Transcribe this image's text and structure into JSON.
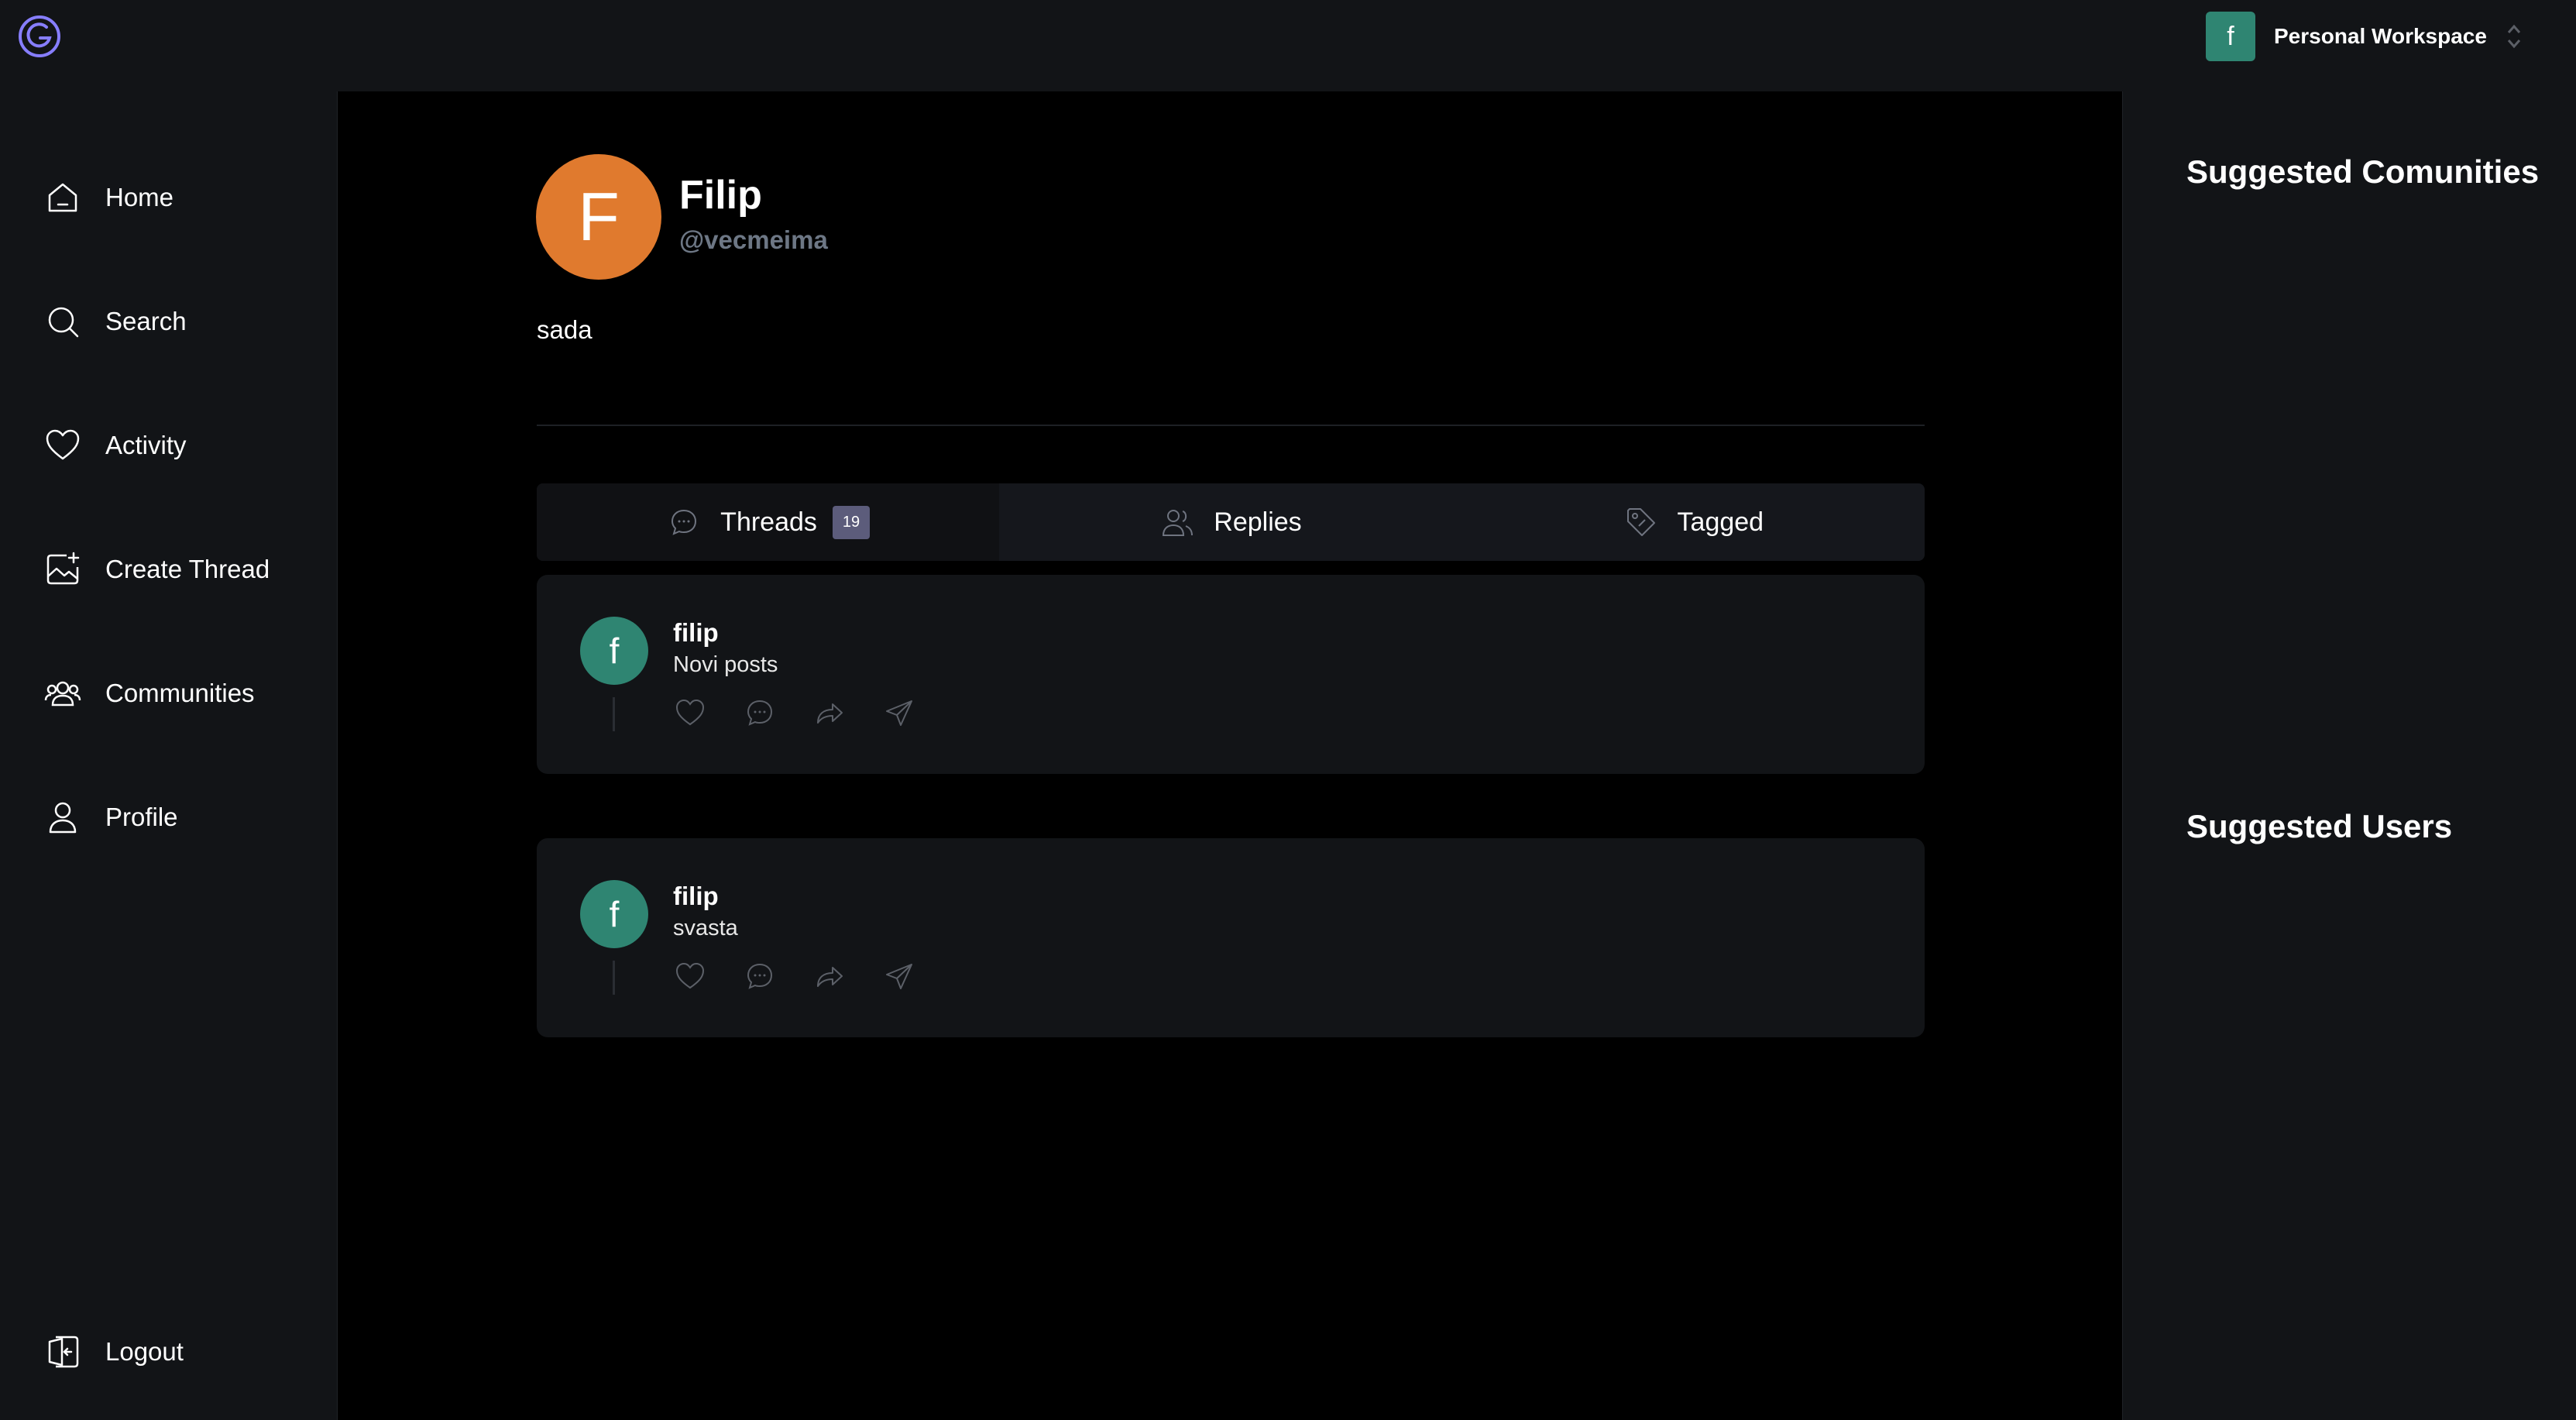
{
  "app": {
    "logo_icon": "app-logo-icon"
  },
  "workspace": {
    "avatar_letter": "f",
    "name": "Personal Workspace",
    "accent": "#2f8572"
  },
  "sidebar": {
    "items": [
      {
        "label": "Home",
        "icon": "home-icon"
      },
      {
        "label": "Search",
        "icon": "search-icon"
      },
      {
        "label": "Activity",
        "icon": "heart-icon"
      },
      {
        "label": "Create Thread",
        "icon": "image-plus-icon"
      },
      {
        "label": "Communities",
        "icon": "users-group-icon"
      },
      {
        "label": "Profile",
        "icon": "user-icon"
      }
    ],
    "logout_label": "Logout"
  },
  "profile": {
    "avatar_letter": "F",
    "avatar_color": "#e07a2e",
    "name": "Filip",
    "handle": "@vecmeima",
    "bio": "sada"
  },
  "tabs": [
    {
      "label": "Threads",
      "count": "19",
      "icon": "chat-bubble-icon",
      "active": true
    },
    {
      "label": "Replies",
      "icon": "users-icon",
      "active": false
    },
    {
      "label": "Tagged",
      "icon": "tag-icon",
      "active": false
    }
  ],
  "threads": [
    {
      "avatar_letter": "f",
      "author": "filip",
      "text": "Novi posts"
    },
    {
      "avatar_letter": "f",
      "author": "filip",
      "text": "svasta"
    }
  ],
  "rightbar": {
    "communities_heading": "Suggested Comunities",
    "users_heading": "Suggested Users"
  }
}
